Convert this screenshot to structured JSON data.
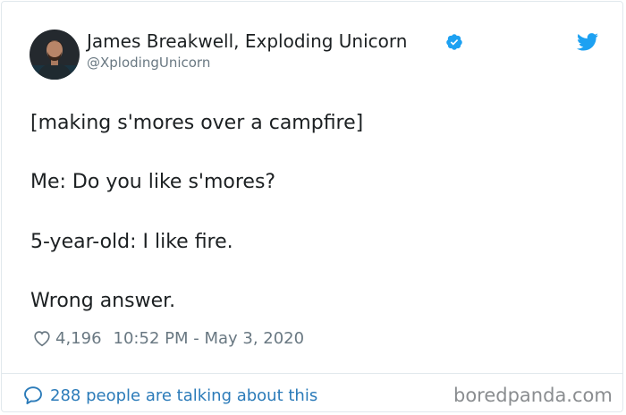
{
  "tweet": {
    "author": {
      "display_name": "James Breakwell, Exploding Unicorn",
      "handle": "@XplodingUnicorn",
      "verified": true,
      "avatar_icon": "profile-photo"
    },
    "body_lines": [
      "[making s'mores over a campfire]",
      "Me: Do you like s'mores?",
      "5-year-old: I like fire.",
      "Wrong answer."
    ],
    "likes": "4,196",
    "timestamp": "10:52 PM - May 3, 2020",
    "conversation_text": "288 people are talking about this",
    "icons": {
      "verified": "verified-badge-icon",
      "brand": "twitter-bird-icon",
      "like": "heart-icon",
      "reply": "speech-bubble-icon"
    }
  },
  "watermark": "boredpanda.com",
  "colors": {
    "text": "#1c2022",
    "muted": "#697882",
    "link": "#2b7bb9",
    "twitter_blue": "#1da1f2",
    "border": "#e1e8ed"
  }
}
